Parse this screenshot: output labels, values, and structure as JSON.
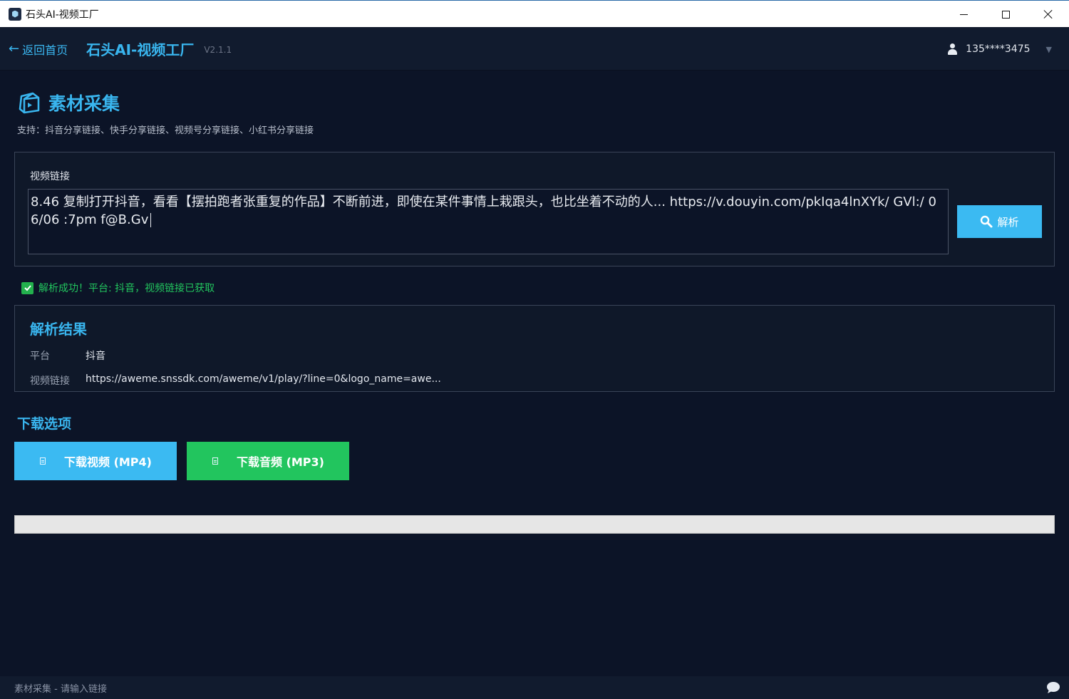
{
  "window": {
    "title": "石头AI-视频工厂",
    "controls": [
      "minimize-icon",
      "maximize-icon",
      "close-icon"
    ]
  },
  "header": {
    "back_arrow": "←",
    "back_label": "返回首页",
    "app_title": "石头AI-视频工厂",
    "version": "V2.1.1",
    "user_phone": "135****3475",
    "user_caret": "▼"
  },
  "page": {
    "title": "素材采集",
    "subtitle": "支持：抖音分享链接、快手分享链接、视频号分享链接、小红书分享链接"
  },
  "input": {
    "label": "视频链接",
    "value": "8.46 复制打开抖音，看看【摆拍跑者张重复的作品】不断前进，即使在某件事情上栽跟头，也比坐着不动的人... https://v.douyin.com/pkIqa4lnXYk/ GVl:/ 06/06 :7pm f@B.Gv",
    "parse_button": "解析"
  },
  "status": {
    "text": "解析成功！平台: 抖音，视频链接已获取"
  },
  "result": {
    "title": "解析结果",
    "rows": [
      {
        "key": "平台",
        "value": "抖音"
      },
      {
        "key": "视频链接",
        "value": "https://aweme.snssdk.com/aweme/v1/play/?line=0&logo_name=awe..."
      }
    ]
  },
  "download": {
    "title": "下载选项",
    "video_button": "下载视频 (MP4)",
    "audio_button": "下载音频 (MP3)"
  },
  "progress": {
    "value": 0
  },
  "statusbar": {
    "text": "素材采集 - 请输入链接"
  },
  "colors": {
    "accent": "#39b5ee",
    "success": "#22c55e",
    "background": "#0c1427",
    "panel": "#0f1829"
  }
}
